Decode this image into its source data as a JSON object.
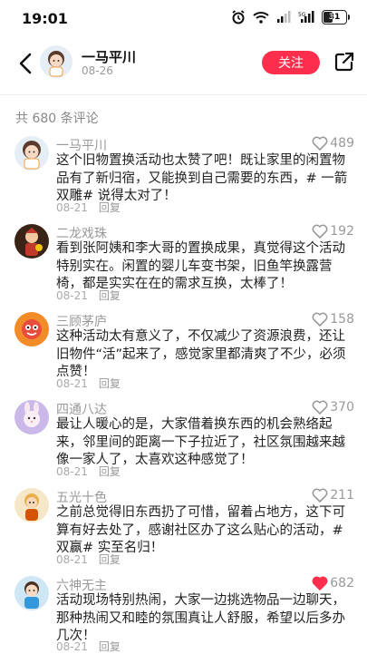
{
  "status": {
    "time": "19:01",
    "battery": "31"
  },
  "header": {
    "username": "一马平川",
    "date": "08-26",
    "follow_label": "关注"
  },
  "comments_header": {
    "total": "共 680 条评论"
  },
  "colors": {
    "accent": "#ff2e4d",
    "liked_heart": "#ff2e4d"
  },
  "comments": [
    {
      "name": "一马平川",
      "text": "这个旧物置换活动也太赞了吧！既让家里的闲置物品有了新归宿，又能换到自己需要的东西，# 一箭双雕# 说得太对了！",
      "date": "08-21",
      "reply": "回复",
      "likes": "489",
      "liked": false,
      "avatar_icon": "girl-avatar-icon"
    },
    {
      "name": "二龙戏珠",
      "text": "看到张阿姨和李大哥的置换成果，真觉得这个活动特别实在。闲置的婴儿车变书架，旧鱼竿换露营椅，都是实实在在的需求互换，太棒了！",
      "date": "08-21",
      "reply": "回复",
      "likes": "192",
      "liked": false,
      "avatar_icon": "dragon-avatar-icon"
    },
    {
      "name": "三顾茅庐",
      "text": "这种活动太有意义了，不仅减少了资源浪费，还让旧物件“活”起来了，感觉家里都清爽了不少，必须点赞！",
      "date": "08-21",
      "reply": "回复",
      "likes": "158",
      "liked": false,
      "avatar_icon": "mascot-avatar-icon"
    },
    {
      "name": "四通八达",
      "text": "最让人暖心的是，大家借着换东西的机会熟络起来，邻里间的距离一下子拉近了，社区氛围越来越像一家人了，太喜欢这种感觉了！",
      "date": "08-21",
      "reply": "回复",
      "likes": "370",
      "liked": false,
      "avatar_icon": "bunny-avatar-icon"
    },
    {
      "name": "五光十色",
      "text": "之前总觉得旧东西扔了可惜，留着占地方，这下可算有好去处了，感谢社区办了这么贴心的活动，# 双赢# 实至名归！",
      "date": "08-21",
      "reply": "回复",
      "likes": "211",
      "liked": false,
      "avatar_icon": "doll-avatar-icon"
    },
    {
      "name": "六神无主",
      "text": "活动现场特别热闹，大家一边挑选物品一边聊天，那种热闹又和睦的氛围真让人舒服，希望以后多办几次！",
      "date": "08-21",
      "reply": "回复",
      "likes": "682",
      "liked": true,
      "avatar_icon": "boy-avatar-icon"
    }
  ]
}
